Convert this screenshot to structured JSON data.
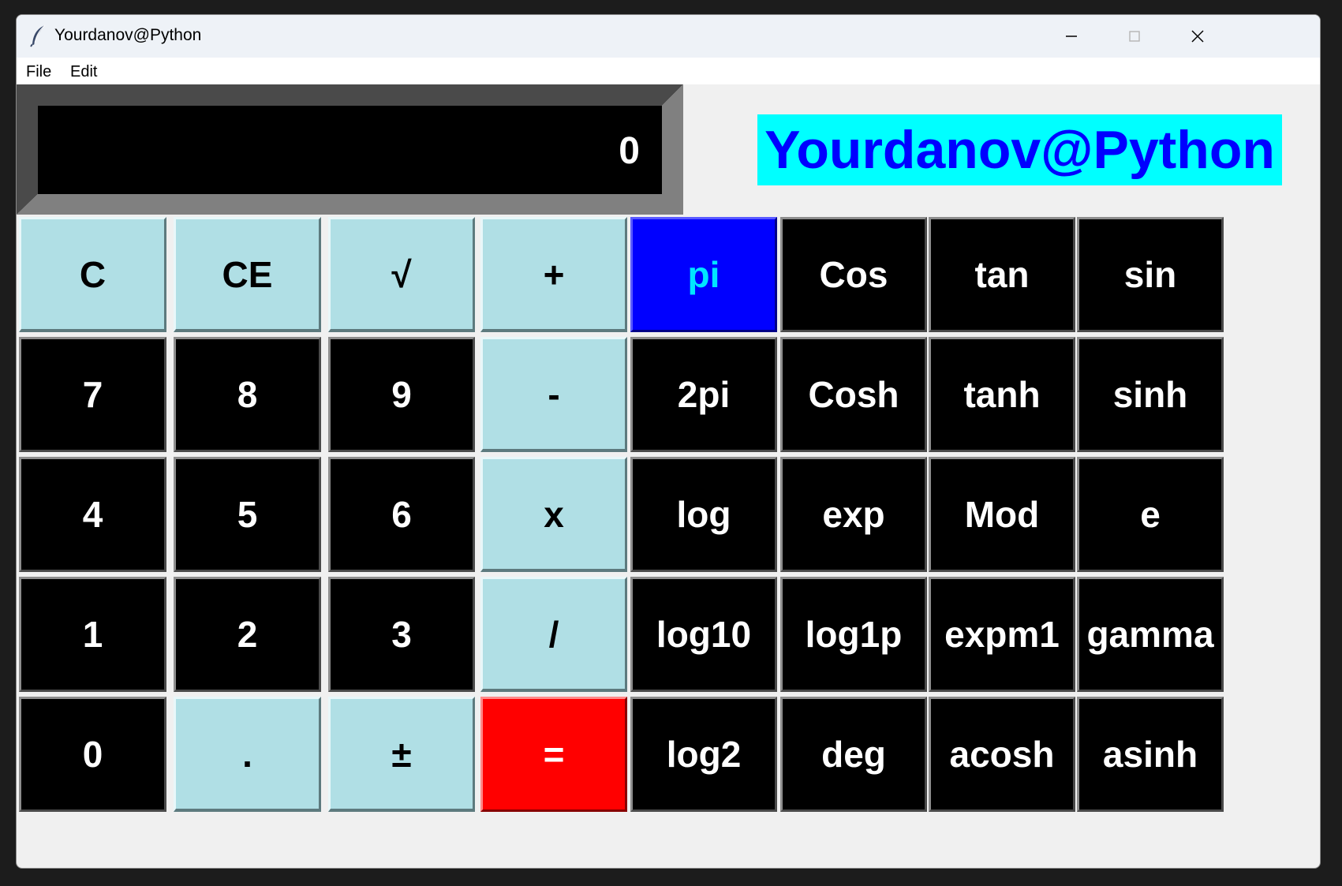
{
  "window": {
    "title": "Yourdanov@Python",
    "controls": [
      "minimize-icon",
      "maximize-icon",
      "close-icon"
    ]
  },
  "menu": {
    "items": [
      "File",
      "Edit"
    ]
  },
  "display": {
    "value": "0"
  },
  "brand": {
    "label": "Yourdanov@Python"
  },
  "colors": {
    "light_button": "#b0dfe5",
    "dark_button": "#000000",
    "pi_button": "#0000ff",
    "pi_text": "#00e5ff",
    "equals_button": "#ff0000",
    "brand_bg": "#00ffff",
    "brand_text": "#0000ff"
  },
  "keypad": {
    "rows": [
      [
        {
          "label": "C",
          "name": "clear-button",
          "style": "light"
        },
        {
          "label": "CE",
          "name": "clear-entry-button",
          "style": "light"
        },
        {
          "label": "√",
          "name": "sqrt-button",
          "style": "light"
        },
        {
          "label": "+",
          "name": "add-button",
          "style": "light"
        },
        {
          "label": "pi",
          "name": "pi-button",
          "style": "blue"
        },
        {
          "label": "Cos",
          "name": "cos-button",
          "style": "dark"
        },
        {
          "label": "tan",
          "name": "tan-button",
          "style": "dark"
        },
        {
          "label": "sin",
          "name": "sin-button",
          "style": "dark"
        }
      ],
      [
        {
          "label": "7",
          "name": "digit-7-button",
          "style": "dark"
        },
        {
          "label": "8",
          "name": "digit-8-button",
          "style": "dark"
        },
        {
          "label": "9",
          "name": "digit-9-button",
          "style": "dark"
        },
        {
          "label": "-",
          "name": "subtract-button",
          "style": "light"
        },
        {
          "label": "2pi",
          "name": "two-pi-button",
          "style": "dark"
        },
        {
          "label": "Cosh",
          "name": "cosh-button",
          "style": "dark"
        },
        {
          "label": "tanh",
          "name": "tanh-button",
          "style": "dark"
        },
        {
          "label": "sinh",
          "name": "sinh-button",
          "style": "dark"
        }
      ],
      [
        {
          "label": "4",
          "name": "digit-4-button",
          "style": "dark"
        },
        {
          "label": "5",
          "name": "digit-5-button",
          "style": "dark"
        },
        {
          "label": "6",
          "name": "digit-6-button",
          "style": "dark"
        },
        {
          "label": "x",
          "name": "multiply-button",
          "style": "light"
        },
        {
          "label": "log",
          "name": "log-button",
          "style": "dark"
        },
        {
          "label": "exp",
          "name": "exp-button",
          "style": "dark"
        },
        {
          "label": "Mod",
          "name": "mod-button",
          "style": "dark"
        },
        {
          "label": "e",
          "name": "e-button",
          "style": "dark"
        }
      ],
      [
        {
          "label": "1",
          "name": "digit-1-button",
          "style": "dark"
        },
        {
          "label": "2",
          "name": "digit-2-button",
          "style": "dark"
        },
        {
          "label": "3",
          "name": "digit-3-button",
          "style": "dark"
        },
        {
          "label": "/",
          "name": "divide-button",
          "style": "light"
        },
        {
          "label": "log10",
          "name": "log10-button",
          "style": "dark"
        },
        {
          "label": "log1p",
          "name": "log1p-button",
          "style": "dark"
        },
        {
          "label": "expm1",
          "name": "expm1-button",
          "style": "dark"
        },
        {
          "label": "gamma",
          "name": "gamma-button",
          "style": "dark"
        }
      ],
      [
        {
          "label": "0",
          "name": "digit-0-button",
          "style": "dark"
        },
        {
          "label": ".",
          "name": "decimal-point-button",
          "style": "light"
        },
        {
          "label": "±",
          "name": "plus-minus-button",
          "style": "light"
        },
        {
          "label": "=",
          "name": "equals-button",
          "style": "red"
        },
        {
          "label": "log2",
          "name": "log2-button",
          "style": "dark"
        },
        {
          "label": "deg",
          "name": "deg-button",
          "style": "dark"
        },
        {
          "label": "acosh",
          "name": "acosh-button",
          "style": "dark"
        },
        {
          "label": "asinh",
          "name": "asinh-button",
          "style": "dark"
        }
      ]
    ]
  }
}
